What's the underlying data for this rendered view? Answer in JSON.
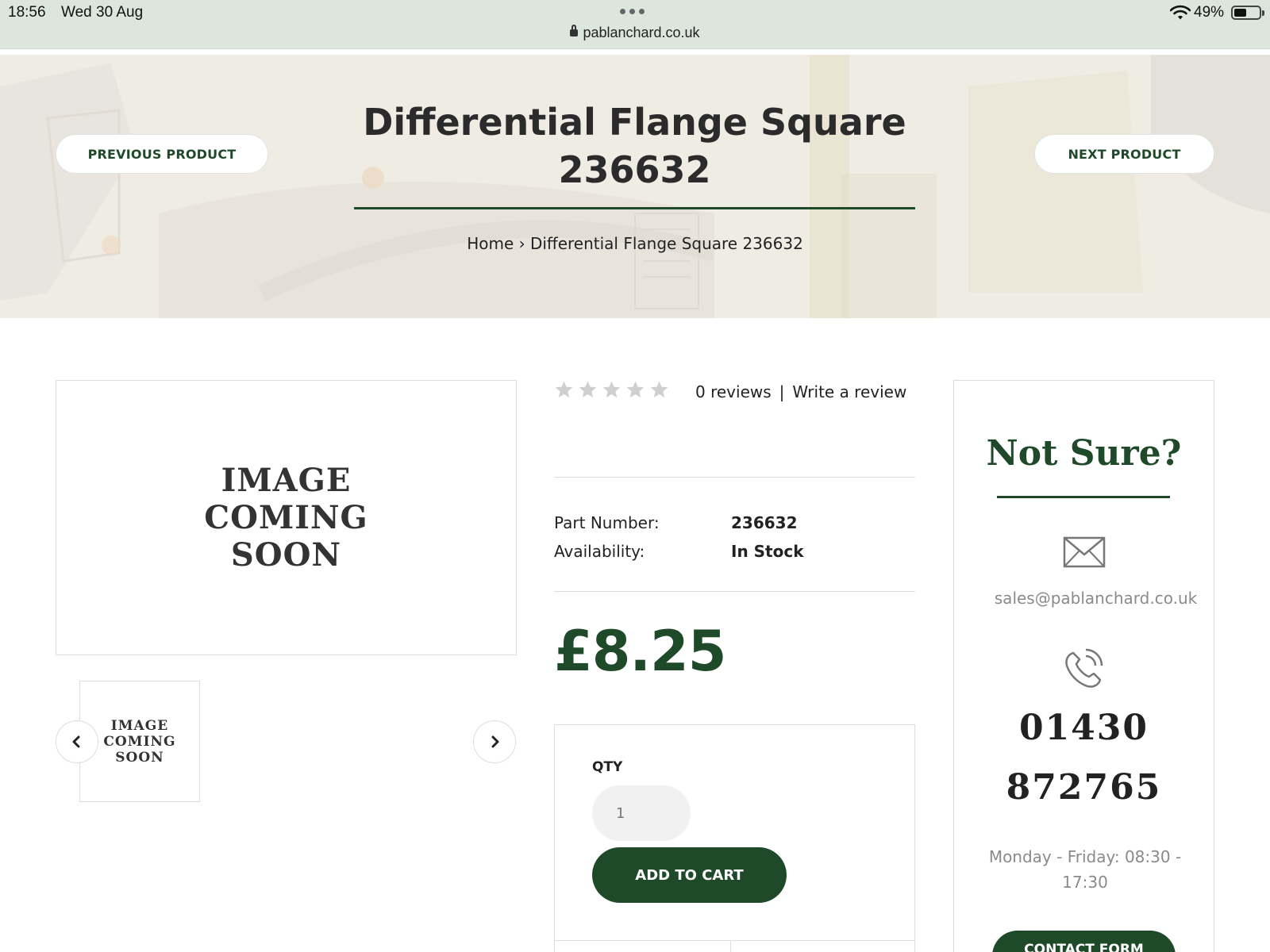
{
  "status_bar": {
    "time": "18:56",
    "date": "Wed 30 Aug",
    "url": "pablanchard.co.uk",
    "battery_percent": "49%",
    "battery_level": 0.49,
    "icons": [
      "lock-icon",
      "wifi-icon",
      "battery-icon"
    ]
  },
  "hero": {
    "prev_label": "PREVIOUS PRODUCT",
    "next_label": "NEXT PRODUCT",
    "title": "Differential Flange Square 236632",
    "breadcrumb": {
      "home": "Home",
      "separator": "›",
      "current": "Differential Flange Square 236632"
    }
  },
  "gallery": {
    "placeholder_lines": [
      "IMAGE",
      "COMING",
      "SOON"
    ],
    "nav_icons": [
      "chevron-left-icon",
      "chevron-right-icon"
    ]
  },
  "product": {
    "rating": {
      "stars_filled": 0,
      "stars_total": 5
    },
    "reviews_label": "0 reviews",
    "review_separator": "|",
    "write_review_label": "Write a review",
    "specs": [
      {
        "label": "Part Number:",
        "value": "236632"
      },
      {
        "label": "Availability:",
        "value": "In Stock"
      }
    ],
    "price": "£8.25",
    "qty_label": "QTY",
    "qty_value": "1",
    "add_to_cart_label": "ADD TO CART"
  },
  "sidebar": {
    "title": "Not Sure?",
    "email": "sales@pablanchard.co.uk",
    "phone_lines": [
      "01430",
      "872765"
    ],
    "hours": "Monday - Friday: 08:30 - 17:30",
    "contact_label": "CONTACT FORM",
    "icons": [
      "envelope-icon",
      "phone-icon"
    ]
  },
  "colors": {
    "brand_green": "#1f4a2a",
    "status_bar_bg": "#dde6dd",
    "muted_text": "#8a8a8a",
    "star_grey": "#cfcfcf"
  }
}
